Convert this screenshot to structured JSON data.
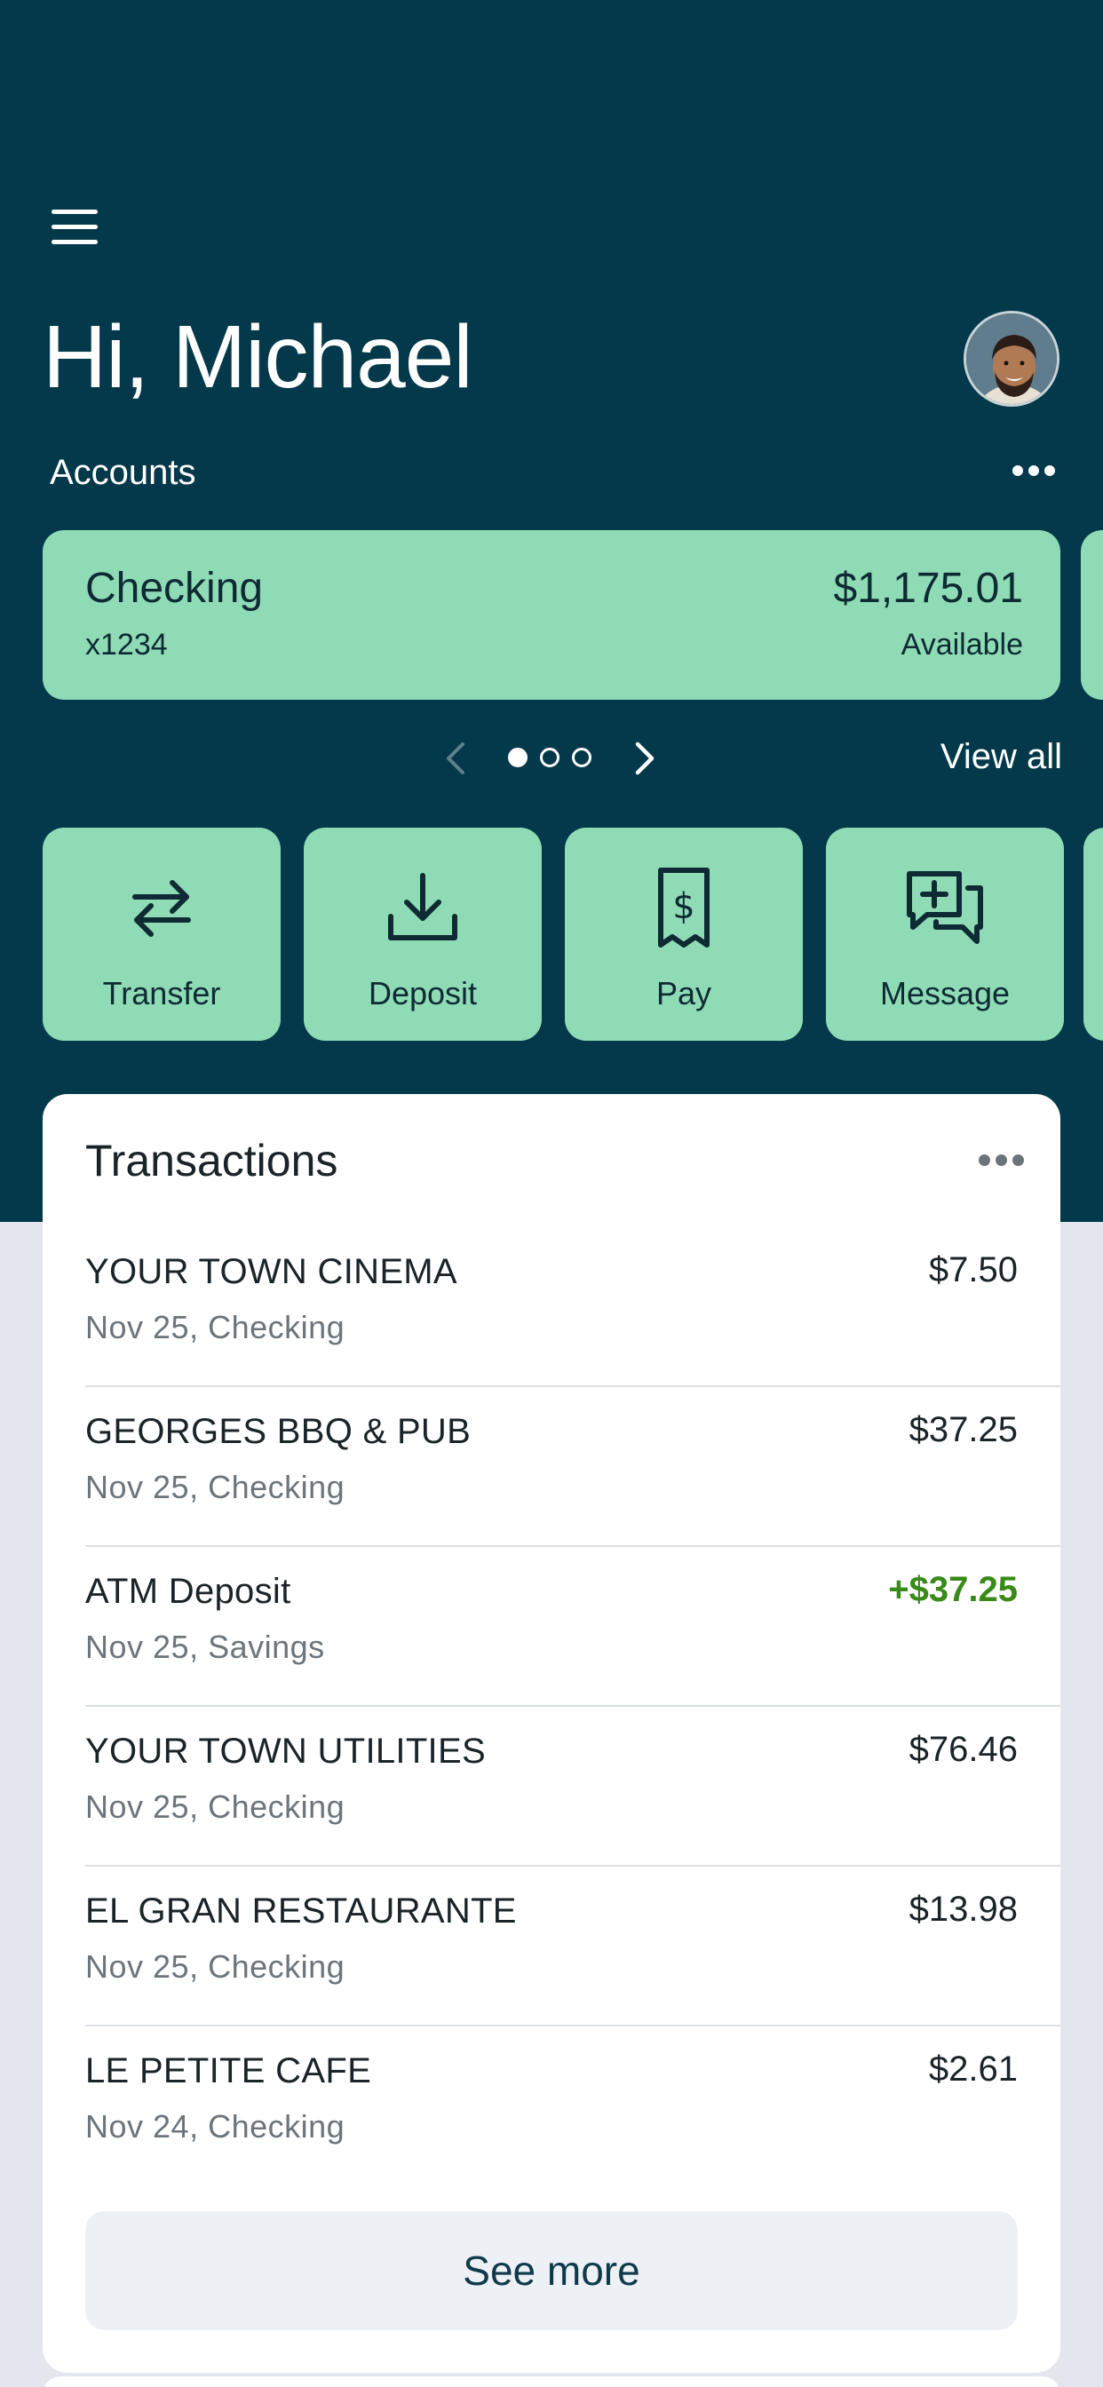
{
  "header": {
    "greeting": "Hi, Michael",
    "accounts_label": "Accounts",
    "view_all": "View all"
  },
  "account": {
    "name": "Checking",
    "number": "x1234",
    "balance": "$1,175.01",
    "balance_label": "Available"
  },
  "carousel": {
    "pages": 3,
    "current_page": 1
  },
  "actions": [
    {
      "label": "Transfer",
      "icon": "transfer-icon"
    },
    {
      "label": "Deposit",
      "icon": "deposit-icon"
    },
    {
      "label": "Pay",
      "icon": "pay-bill-icon"
    },
    {
      "label": "Message",
      "icon": "message-icon"
    }
  ],
  "transactions": {
    "title": "Transactions",
    "items": [
      {
        "merchant": "YOUR TOWN CINEMA",
        "meta": "Nov 25, Checking",
        "amount": "$7.50",
        "credit": false
      },
      {
        "merchant": "GEORGES BBQ & PUB",
        "meta": "Nov 25, Checking",
        "amount": "$37.25",
        "credit": false
      },
      {
        "merchant": "ATM Deposit",
        "meta": "Nov 25, Savings",
        "amount": "+$37.25",
        "credit": true
      },
      {
        "merchant": "YOUR TOWN UTILITIES",
        "meta": "Nov 25, Checking",
        "amount": "$76.46",
        "credit": false
      },
      {
        "merchant": "EL GRAN RESTAURANTE",
        "meta": "Nov 25, Checking",
        "amount": "$13.98",
        "credit": false
      },
      {
        "merchant": "LE PETITE CAFE",
        "meta": "Nov 24, Checking",
        "amount": "$2.61",
        "credit": false
      }
    ],
    "see_more": "See more"
  },
  "colors": {
    "header_bg": "#03394a",
    "card_green": "#8fdbb6",
    "credit_green": "#3a8a1a",
    "page_bg": "#e3e6ec"
  }
}
